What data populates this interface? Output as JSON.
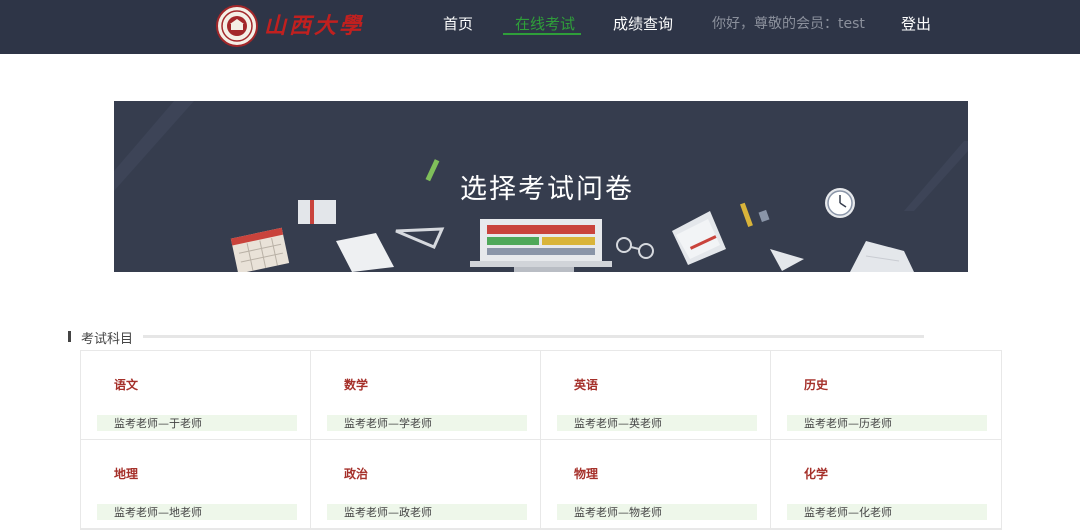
{
  "header": {
    "logo_text": "山西大學",
    "nav": {
      "home": "首页",
      "online_exam": "在线考试",
      "score_query": "成绩查询",
      "greeting": "你好，尊敬的会员：test",
      "logout": "登出"
    },
    "active_color": "#2f9e3a",
    "background_color": "#2e3547"
  },
  "banner": {
    "title": "选择考试问卷",
    "background_color": "#363d4e"
  },
  "section": {
    "title": "考试科目"
  },
  "subjects": [
    {
      "name": "语文",
      "teacher": "监考老师—于老师"
    },
    {
      "name": "数学",
      "teacher": "监考老师—学老师"
    },
    {
      "name": "英语",
      "teacher": "监考老师—英老师"
    },
    {
      "name": "历史",
      "teacher": "监考老师—历老师"
    },
    {
      "name": "地理",
      "teacher": "监考老师—地老师"
    },
    {
      "name": "政治",
      "teacher": "监考老师—政老师"
    },
    {
      "name": "物理",
      "teacher": "监考老师—物老师"
    },
    {
      "name": "化学",
      "teacher": "监考老师—化老师"
    }
  ],
  "icons": [
    "university-seal-icon",
    "pencil-icon",
    "book-icon",
    "calendar-icon",
    "ruler-icon",
    "laptop-icon",
    "glasses-icon",
    "clock-icon",
    "paper-plane-icon",
    "document-icon"
  ]
}
